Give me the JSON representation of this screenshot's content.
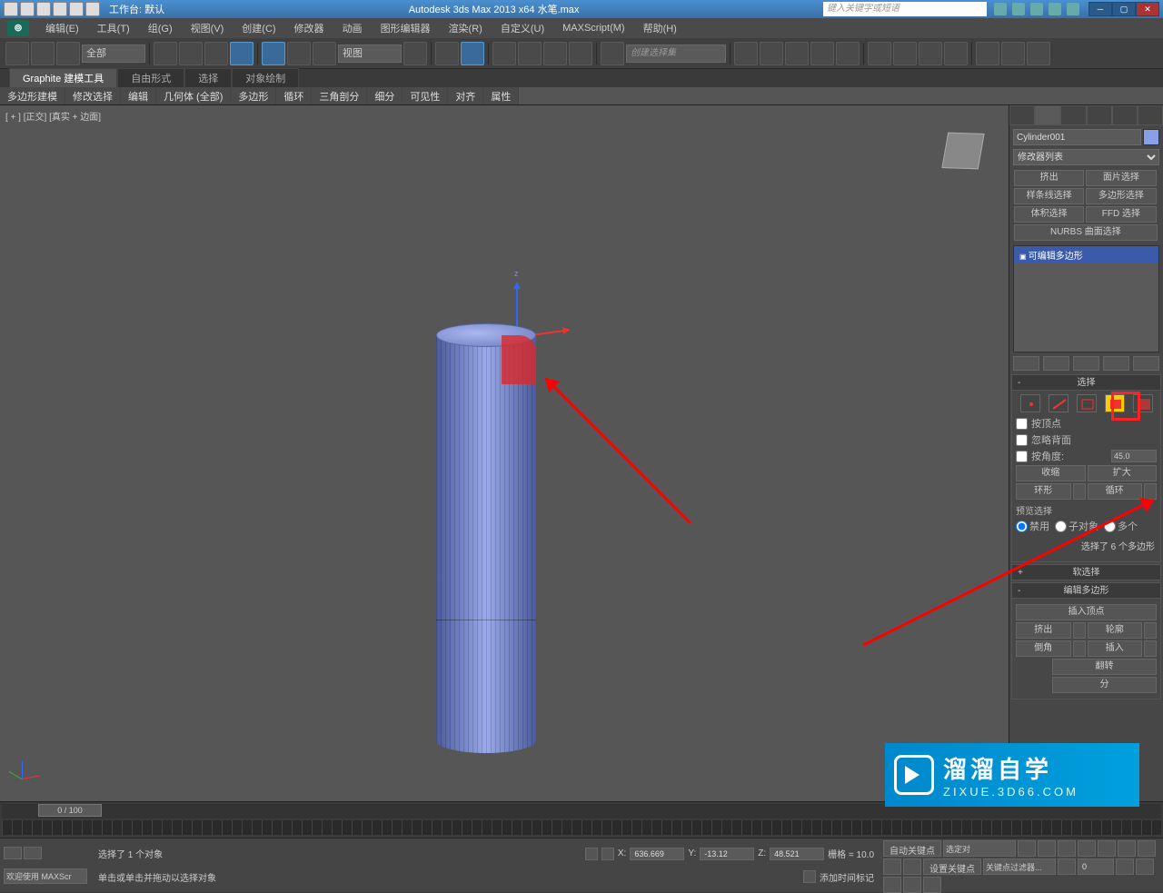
{
  "titlebar": {
    "workspace_label": "工作台: 默认",
    "app_title": "Autodesk 3ds Max  2013 x64   水笔.max",
    "search_placeholder": "键入关键字或短语"
  },
  "menubar": {
    "items": [
      "编辑(E)",
      "工具(T)",
      "组(G)",
      "视图(V)",
      "创建(C)",
      "修改器",
      "动画",
      "图形编辑器",
      "渲染(R)",
      "自定义(U)",
      "MAXScript(M)",
      "帮助(H)"
    ]
  },
  "toolbar": {
    "selection_filter": "全部",
    "ref_coord": "视图",
    "named_set_placeholder": "创建选择集"
  },
  "ribbon": {
    "tabs": [
      "Graphite 建模工具",
      "自由形式",
      "选择",
      "对象绘制"
    ],
    "panels": [
      "多边形建模",
      "修改选择",
      "编辑",
      "几何体 (全部)",
      "多边形",
      "循环",
      "三角剖分",
      "细分",
      "可见性",
      "对齐",
      "属性"
    ]
  },
  "viewport": {
    "label": "[ + ]  [正交]  [真实 + 边面]"
  },
  "command_panel": {
    "object_name": "Cylinder001",
    "modifier_list_label": "修改器列表",
    "mod_buttons": [
      "挤出",
      "面片选择",
      "样条线选择",
      "多边形选择",
      "体积选择",
      "FFD 选择"
    ],
    "nurbs_btn": "NURBS 曲面选择",
    "stack_item": "可编辑多边形",
    "rollouts": {
      "selection_head": "选择",
      "by_vertex": "按顶点",
      "ignore_backfacing": "忽略背面",
      "by_angle": "按角度:",
      "angle_value": "45.0",
      "shrink": "收缩",
      "grow": "扩大",
      "ring": "环形",
      "loop": "循环",
      "preview_label": "预览选择",
      "radio_off": "禁用",
      "radio_subobj": "子对象",
      "radio_multi": "多个",
      "selection_info": "选择了 6 个多边形",
      "soft_sel_head": "软选择",
      "edit_poly_head": "编辑多边形",
      "insert_vertex": "插入顶点",
      "extrude": "挤出",
      "outline": "轮廓",
      "bevel": "倒角",
      "inset": "插入",
      "flip": "翻转",
      "from_edge": "分"
    }
  },
  "timeline": {
    "slider_text": "0 / 100"
  },
  "statusbar": {
    "welcome": "欢迎使用  MAXScr",
    "selected_msg": "选择了 1 个对象",
    "prompt_msg": "单击或单击并拖动以选择对象",
    "coord_x": "636.669",
    "coord_y": "-13.12",
    "coord_z": "48.521",
    "grid": "栅格 = 10.0",
    "add_time_tag": "添加时间标记",
    "auto_key": "自动关键点",
    "set_key": "设置关键点",
    "selected_set": "选定对",
    "key_filters": "关键点过滤器..."
  },
  "watermark": {
    "title": "溜溜自学",
    "url": "ZIXUE.3D66.COM"
  }
}
